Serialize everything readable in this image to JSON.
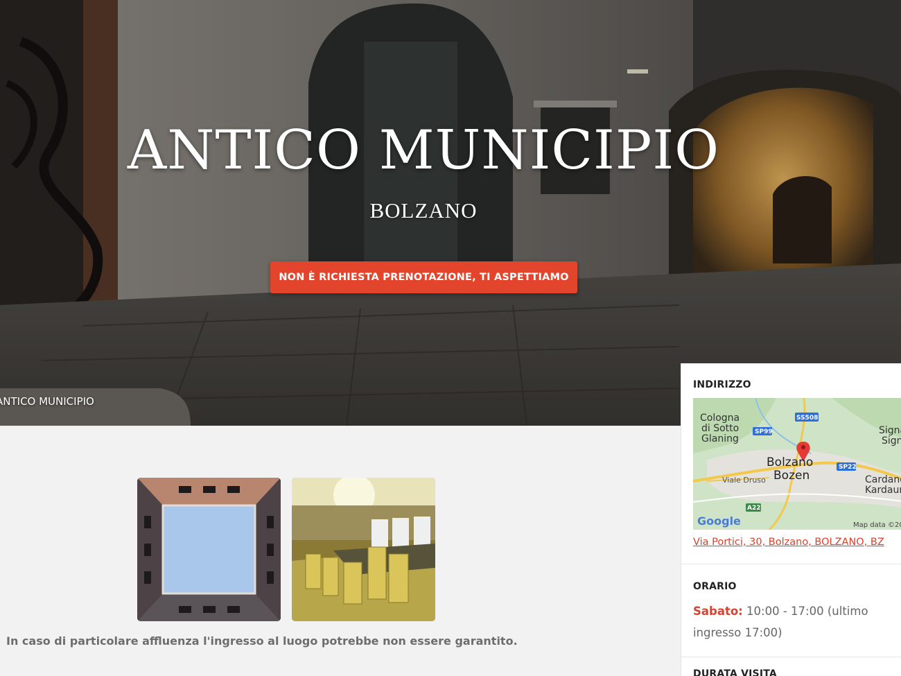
{
  "hero": {
    "title": "ANTICO MUNICIPIO",
    "subtitle": "BOLZANO",
    "cta_label": "NON È RICHIESTA PRENOTAZIONE, TI ASPETTIAMO",
    "breadcrumb": "ANTICO MUNICIPIO"
  },
  "sidebar": {
    "address_label": "INDIRIZZO",
    "address": "Via Portici, 30, Bolzano, BOLZANO, BZ",
    "map": {
      "labels": [
        "Cologna",
        "di Sotto",
        "Glaning",
        "Bolzano",
        "Bozen",
        "Viale Druso",
        "Cardano",
        "Kardaun",
        "Signa",
        "Sign"
      ],
      "road_badges": [
        "SS508",
        "SP99",
        "SP22",
        "A22"
      ],
      "brand": "Google",
      "attribution": "Map data ©20"
    },
    "hours_label": "ORARIO",
    "hours_day": "Sabato:",
    "hours_value": "10:00 - 17:00 (ultimo ingresso 17:00)",
    "duration_label": "DURATA VISITA"
  },
  "gallery": {
    "note": "In caso di particolare affluenza l'ingresso al luogo potrebbe non essere garantito."
  },
  "colors": {
    "accent": "#e2452c",
    "link": "#d9422c",
    "page_bg": "#f2f2f2"
  }
}
